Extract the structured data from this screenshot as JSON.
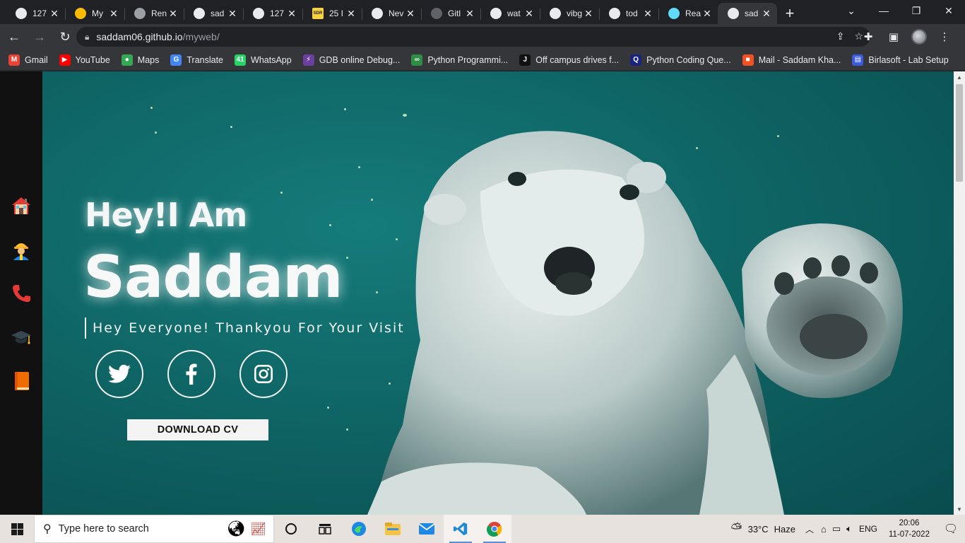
{
  "browser": {
    "tabs": [
      {
        "title": "127",
        "favicon": "globe-icon",
        "color": "#e8eaed"
      },
      {
        "title": "My",
        "favicon": "drive-icon",
        "color": "#fbbc04"
      },
      {
        "title": "Ren",
        "favicon": "layers-icon",
        "color": "#9aa0a6"
      },
      {
        "title": "sad",
        "favicon": "globe-icon",
        "color": "#e8eaed"
      },
      {
        "title": "127",
        "favicon": "globe-icon",
        "color": "#e8eaed"
      },
      {
        "title": "25 I",
        "favicon": "sdr-icon",
        "color": "#f9d03e",
        "badge": "SDR"
      },
      {
        "title": "Nev",
        "favicon": "chrome-icon",
        "color": "#e8eaed"
      },
      {
        "title": "Gitl",
        "favicon": "github-icon",
        "color": "#5f6368"
      },
      {
        "title": "wat",
        "favicon": "globe-icon",
        "color": "#e8eaed"
      },
      {
        "title": "vibg",
        "favicon": "globe-icon",
        "color": "#e8eaed"
      },
      {
        "title": "tod",
        "favicon": "globe-icon",
        "color": "#e8eaed"
      },
      {
        "title": "Rea",
        "favicon": "react-icon",
        "color": "#61dafb"
      },
      {
        "title": "sad",
        "favicon": "globe-icon",
        "color": "#e8eaed",
        "active": true
      }
    ],
    "url_host": "saddam06.github.io",
    "url_path": "/myweb/",
    "bookmarks": [
      {
        "label": "Gmail",
        "icon": "gmail-icon",
        "color": "#ea4335",
        "glyph": "M"
      },
      {
        "label": "YouTube",
        "icon": "youtube-icon",
        "color": "#ff0000",
        "glyph": "▶"
      },
      {
        "label": "Maps",
        "icon": "maps-icon",
        "color": "#34a853",
        "glyph": "●"
      },
      {
        "label": "Translate",
        "icon": "translate-icon",
        "color": "#4285f4",
        "glyph": "G"
      },
      {
        "label": "WhatsApp",
        "icon": "whatsapp-icon",
        "color": "#25d366",
        "glyph": "41"
      },
      {
        "label": "GDB online Debug...",
        "icon": "gdb-icon",
        "color": "#6b3fa0",
        "glyph": "⚡"
      },
      {
        "label": "Python Programmi...",
        "icon": "gfg-icon",
        "color": "#2f8d46",
        "glyph": "∞"
      },
      {
        "label": "Off campus drives f...",
        "icon": "jobs-icon",
        "color": "#111111",
        "glyph": "J"
      },
      {
        "label": "Python Coding Que...",
        "icon": "quiz-icon",
        "color": "#1a237e",
        "glyph": "Q"
      },
      {
        "label": "Mail - Saddam Kha...",
        "icon": "outlook-icon",
        "color": "#f25022",
        "glyph": "■"
      },
      {
        "label": "Birlasoft - Lab Setup",
        "icon": "birlasoft-icon",
        "color": "#3b5bdb",
        "glyph": "▤"
      }
    ]
  },
  "site": {
    "greeting": "Hey!I Am",
    "name": "Saddam",
    "tagline": "Hey Everyone! Thankyou For Your Visit",
    "cv_button": "DOWNLOAD CV",
    "nav_icons": [
      "home-icon",
      "worker-icon",
      "phone-icon",
      "graduation-cap-icon",
      "book-icon"
    ],
    "social": [
      "twitter-icon",
      "facebook-icon",
      "instagram-icon"
    ]
  },
  "taskbar": {
    "search_placeholder": "Type here to search",
    "weather_temp": "33°C",
    "weather_text": "Haze",
    "language": "ENG",
    "time": "20:06",
    "date": "11-07-2022"
  }
}
